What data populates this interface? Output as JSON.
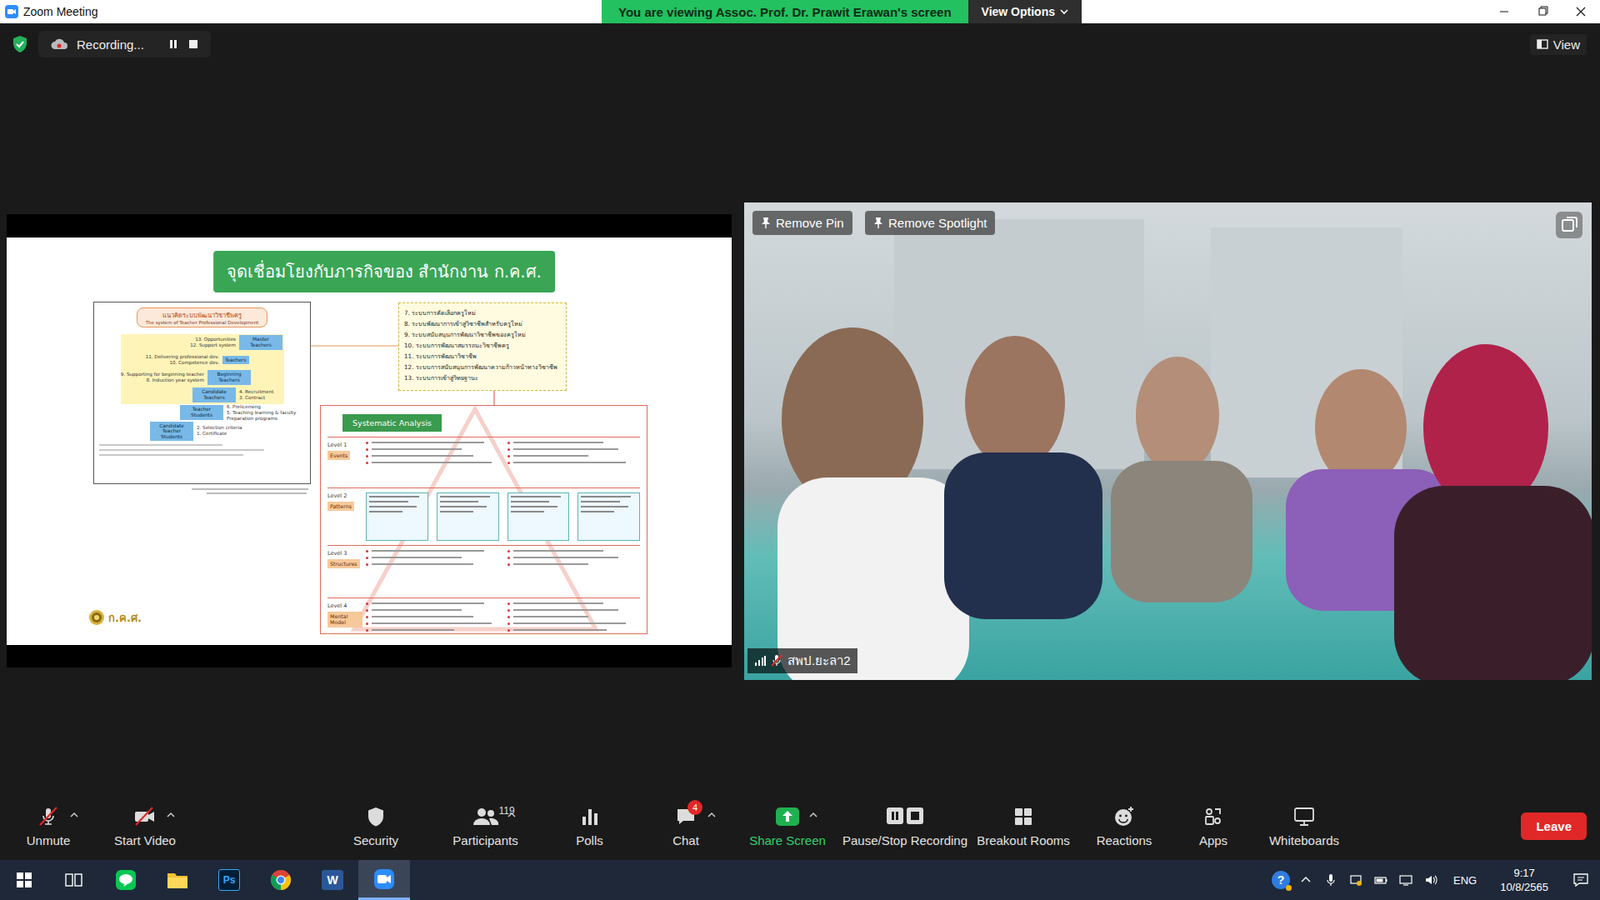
{
  "window": {
    "title": "Zoom Meeting"
  },
  "banner": {
    "text": "You are viewing Assoc. Prof. Dr. Prawit Erawan's screen",
    "options": "View Options"
  },
  "recording": {
    "label": "Recording..."
  },
  "view_button": {
    "label": "View"
  },
  "slide": {
    "title": "จุดเชื่อมโยงกับภารกิจของ สำนักงาน ก.ค.ศ.",
    "diagram": {
      "header": "แนวคิดระบบพัฒนาวิชาชีพครู",
      "subtitle": "The system of Teacher Professional Development",
      "roles": [
        {
          "label": "Master Teachers",
          "left_notes": [
            "13. Opportunities",
            "12. Support system"
          ],
          "right_notes": []
        },
        {
          "label": "Teachers",
          "left_notes": [
            "11. Delivering professional dev.",
            "10. Competence dev."
          ],
          "right_notes": []
        },
        {
          "label": "Beginning Teachers",
          "left_notes": [
            "9. Supporting for beginning teacher",
            "8. Induction year system"
          ],
          "right_notes": []
        },
        {
          "label": "Candidate Teachers",
          "left_notes": [],
          "right_notes": [
            "4. Recruitment",
            "3. Contract"
          ]
        },
        {
          "label": "Teacher Students",
          "left_notes": [],
          "right_notes": [
            "6. Prelicensing",
            "5. Teaching learning & faculty",
            "Preparation programs"
          ]
        },
        {
          "label": "Candidate Teacher Students",
          "left_notes": [],
          "right_notes": [
            "2. Selection criteria",
            "1. Certificate"
          ]
        }
      ]
    },
    "systems": [
      "7. ระบบการคัดเลือกครูใหม่",
      "8. ระบบพัฒนาการเข้าสู่วิชาชีพสำหรับครูใหม่",
      "9. ระบบสนับสนุนการพัฒนาวิชาชีพของครูใหม่",
      "10. ระบบการพัฒนาสมรรถนะวิชาชีพครู",
      "11. ระบบการพัฒนาวิชาชีพ",
      "12. ระบบการสนับสนุนการพัฒนาความก้าวหน้าทางวิชาชีพ",
      "13. ระบบการเข้าสู่วิทยฐานะ"
    ],
    "analysis": {
      "tag": "Systematic Analysis",
      "levels": [
        {
          "level": "Level 1",
          "name": "Events"
        },
        {
          "level": "Level 2",
          "name": "Patterns"
        },
        {
          "level": "Level 3",
          "name": "Structures"
        },
        {
          "level": "Level 4",
          "name": "Mental Model"
        }
      ]
    },
    "logo": "ก.ค.ศ."
  },
  "video": {
    "pin_button": "Remove Pin",
    "spotlight_button": "Remove Spotlight",
    "participant": "สพป.ยะลา2",
    "muted": true
  },
  "toolbar": [
    {
      "label": "Unmute",
      "off": true,
      "menu": true,
      "highlight": false
    },
    {
      "label": "Start Video",
      "off": true,
      "menu": true,
      "highlight": false
    },
    {
      "label": "Security",
      "off": false,
      "menu": false,
      "highlight": false
    },
    {
      "label": "Participants",
      "off": false,
      "menu": true,
      "highlight": false,
      "count": "119"
    },
    {
      "label": "Polls",
      "off": false,
      "menu": false,
      "highlight": false
    },
    {
      "label": "Chat",
      "off": false,
      "menu": true,
      "highlight": false,
      "badge": "4"
    },
    {
      "label": "Share Screen",
      "off": false,
      "menu": true,
      "highlight": true
    },
    {
      "label": "Pause/Stop Recording",
      "off": false,
      "menu": false,
      "highlight": false
    },
    {
      "label": "Breakout Rooms",
      "off": false,
      "menu": false,
      "highlight": false
    },
    {
      "label": "Reactions",
      "off": false,
      "menu": false,
      "highlight": false
    },
    {
      "label": "Apps",
      "off": false,
      "menu": false,
      "highlight": false
    },
    {
      "label": "Whiteboards",
      "off": false,
      "menu": false,
      "highlight": false
    }
  ],
  "leave": "Leave",
  "taskbar": {
    "apps": [
      {
        "active": false
      },
      {
        "active": false
      },
      {
        "active": false
      },
      {
        "active": false
      },
      {
        "label": "Ps",
        "active": false
      },
      {
        "active": false
      },
      {
        "label": "W",
        "active": false
      },
      {
        "active": true
      }
    ],
    "help": "?",
    "language": "ENG",
    "time": "9:17",
    "date": "10/8/2565"
  }
}
